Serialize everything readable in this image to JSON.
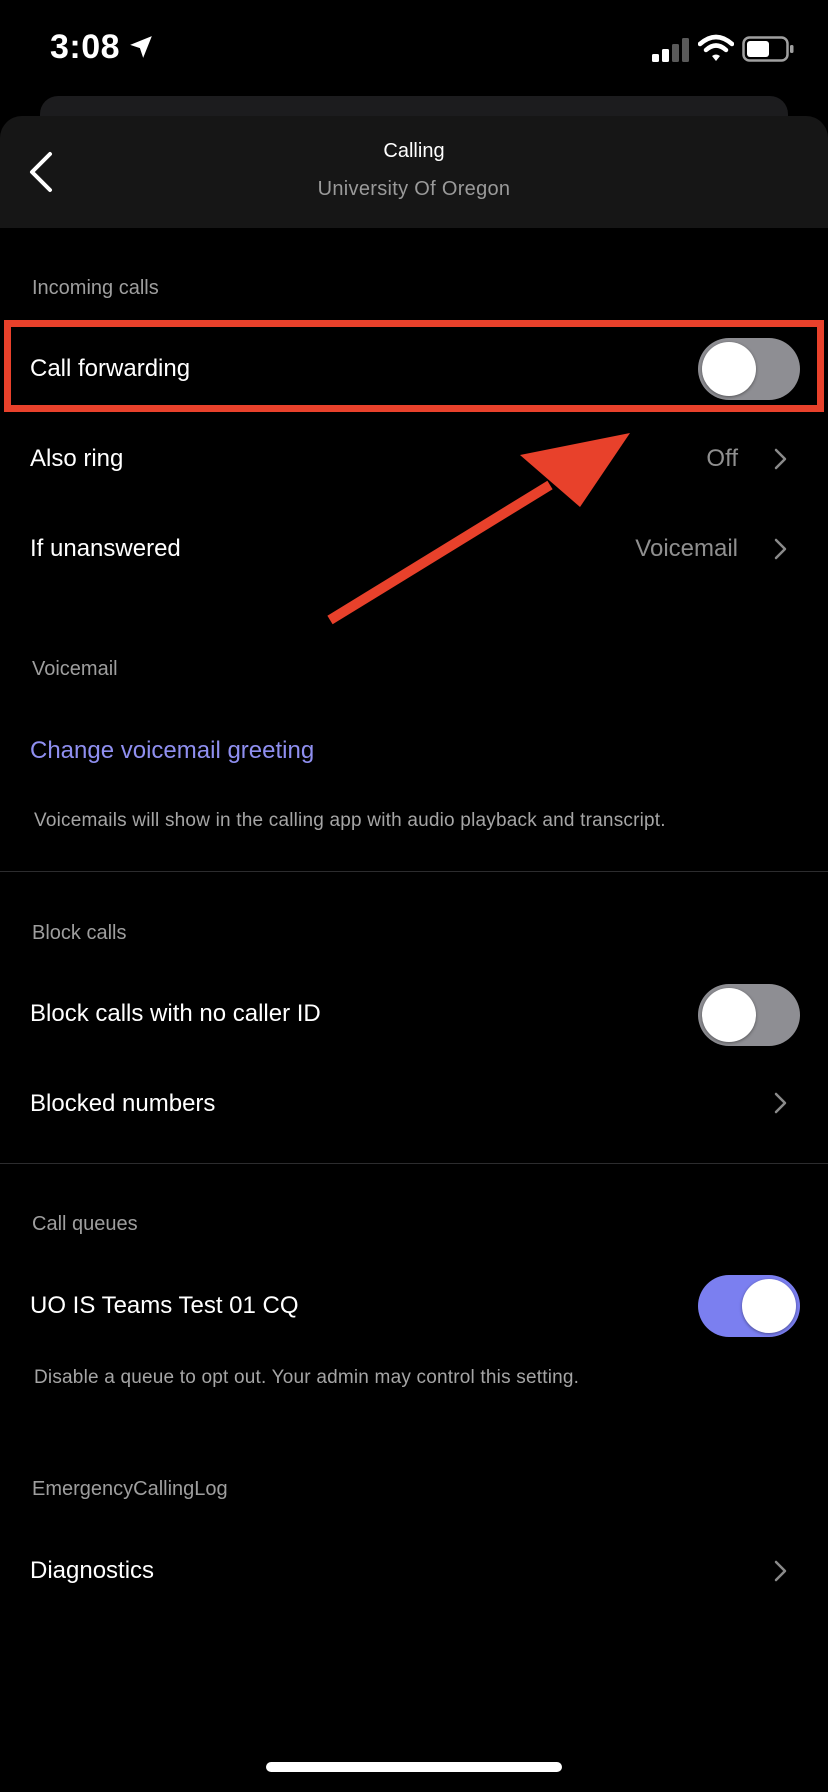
{
  "status_bar": {
    "time": "3:08"
  },
  "header": {
    "title": "Calling",
    "subtitle": "University Of Oregon"
  },
  "incoming": {
    "label": "Incoming calls",
    "call_forwarding": {
      "label": "Call forwarding",
      "on": false
    },
    "also_ring": {
      "label": "Also ring",
      "value": "Off"
    },
    "if_unanswered": {
      "label": "If unanswered",
      "value": "Voicemail"
    }
  },
  "voicemail": {
    "label": "Voicemail",
    "change_greeting": "Change voicemail greeting",
    "note": "Voicemails will show in the calling app with audio playback and transcript."
  },
  "block": {
    "label": "Block calls",
    "no_caller_id": {
      "label": "Block calls with no caller ID",
      "on": false
    },
    "blocked_numbers": "Blocked numbers"
  },
  "queues": {
    "label": "Call queues",
    "queue": {
      "label": "UO IS Teams Test 01 CQ",
      "on": true
    },
    "note": "Disable a queue to opt out. Your admin may control this setting."
  },
  "emergency": {
    "label": "EmergencyCallingLog",
    "diagnostics": "Diagnostics"
  },
  "colors": {
    "accent": "#7b7ff0",
    "link": "#8f8ff0",
    "annotation": "#e8412b"
  }
}
